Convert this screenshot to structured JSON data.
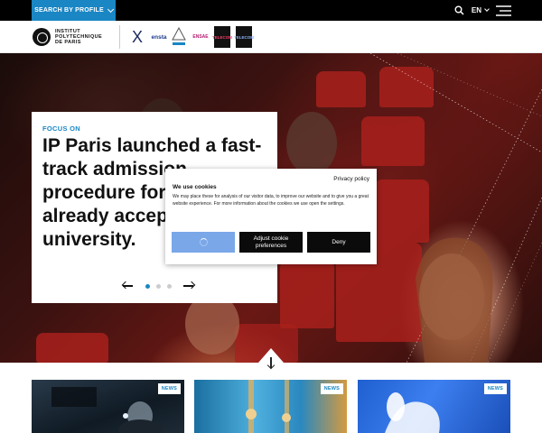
{
  "topbar": {
    "search_profile_label": "SEARCH BY PROFILE",
    "language": "EN"
  },
  "logos": {
    "main_logo_text": "INSTITUT\nPOLYTECHNIQUE\nDE PARIS",
    "partners": [
      "X",
      "ensta",
      "PONTS",
      "ENSAE",
      "TELECOM",
      "TELECOM"
    ]
  },
  "hero": {
    "kicker": "FOCUS ON",
    "headline": "IP Paris launched a fast-track admission procedure for students already accepted to a university.",
    "slides_total": 3,
    "active_slide": 1
  },
  "cookie_dialog": {
    "privacy_link": "Privacy policy",
    "title": "We use cookies",
    "body": "We may place these for analysis of our visitor data, to improve our website and to give you a great website experience. For more information about the cookies we use open the settings.",
    "adjust_label": "Adjust cookie preferences",
    "deny_label": "Deny"
  },
  "news_cards": [
    {
      "badge": "NEWS"
    },
    {
      "badge": "NEWS"
    },
    {
      "badge": "NEWS"
    }
  ],
  "colors": {
    "accent": "#1a86c4",
    "accept_button": "#7aa7e8",
    "dark_button": "#0b0b0b"
  }
}
